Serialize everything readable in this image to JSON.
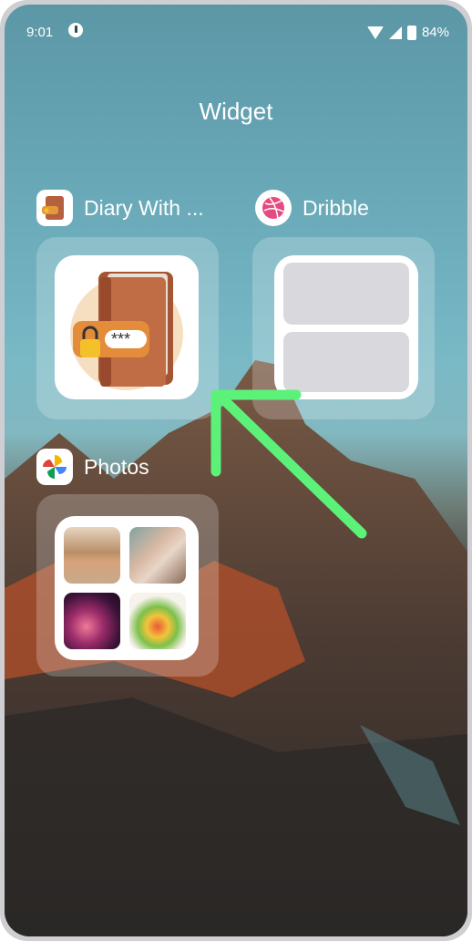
{
  "status_bar": {
    "time": "9:01",
    "battery": "84%"
  },
  "header": {
    "title": "Widget"
  },
  "apps": [
    {
      "label": "Diary With ...",
      "icon": "diary-lock-icon"
    },
    {
      "label": "Dribble",
      "icon": "dribbble-icon"
    },
    {
      "label": "Photos",
      "icon": "photos-pinwheel-icon"
    }
  ],
  "diary_widget": {
    "password_mask": "***"
  },
  "colors": {
    "arrow": "#5cf27a",
    "card": "rgba(255,255,255,0.22)"
  },
  "icons": [
    "notification-icon",
    "wifi-icon",
    "signal-icon",
    "battery-icon",
    "gesture-arrow-icon"
  ]
}
